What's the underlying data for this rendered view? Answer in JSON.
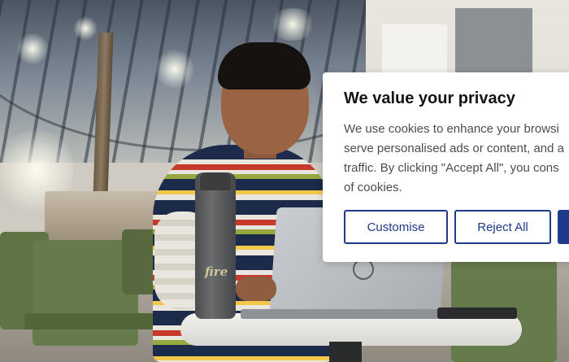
{
  "cookie_banner": {
    "title": "We value your privacy",
    "body_lines": [
      "We use cookies to enhance your browsi",
      "serve personalised ads or content, and a",
      "traffic. By clicking \"Accept All\", you cons",
      "of cookies."
    ],
    "buttons": {
      "customise": "Customise",
      "reject_all": "Reject All",
      "accept_all": ""
    },
    "accent_color": "#1f3a8a"
  },
  "background": {
    "bottle_text": "fire"
  }
}
